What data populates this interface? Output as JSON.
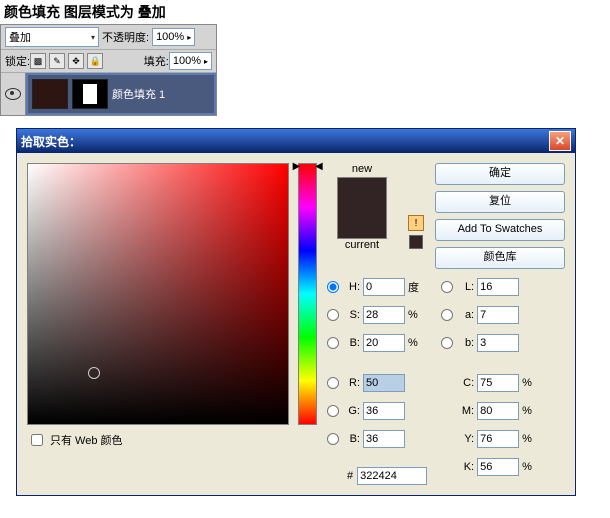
{
  "note": "颜色填充 图层模式为 叠加",
  "panel": {
    "blend_mode": "叠加",
    "opacity_label": "不透明度:",
    "opacity_value": "100%",
    "lock_label": "锁定:",
    "fill_label": "填充:",
    "fill_value": "100%",
    "layer_name": "颜色填充 1"
  },
  "dialog": {
    "title": "拾取实色：",
    "swatch": {
      "new_label": "new",
      "current_label": "current"
    },
    "buttons": {
      "ok": "确定",
      "reset": "复位",
      "add_swatch": "Add To Swatches",
      "library": "颜色库"
    },
    "hsb": {
      "H": {
        "label": "H:",
        "value": "0",
        "unit": "度"
      },
      "S": {
        "label": "S:",
        "value": "28",
        "unit": "%"
      },
      "B": {
        "label": "B:",
        "value": "20",
        "unit": "%"
      }
    },
    "rgb": {
      "R": {
        "label": "R:",
        "value": "50"
      },
      "G": {
        "label": "G:",
        "value": "36"
      },
      "B": {
        "label": "B:",
        "value": "36"
      }
    },
    "lab": {
      "L": {
        "label": "L:",
        "value": "16"
      },
      "a": {
        "label": "a:",
        "value": "7"
      },
      "b": {
        "label": "b:",
        "value": "3"
      }
    },
    "cmyk": {
      "C": {
        "label": "C:",
        "value": "75",
        "unit": "%"
      },
      "M": {
        "label": "M:",
        "value": "80",
        "unit": "%"
      },
      "Y": {
        "label": "Y:",
        "value": "76",
        "unit": "%"
      },
      "K": {
        "label": "K:",
        "value": "56",
        "unit": "%"
      }
    },
    "hex": {
      "prefix": "#",
      "value": "322424"
    },
    "web_only": "只有 Web 颜色"
  }
}
